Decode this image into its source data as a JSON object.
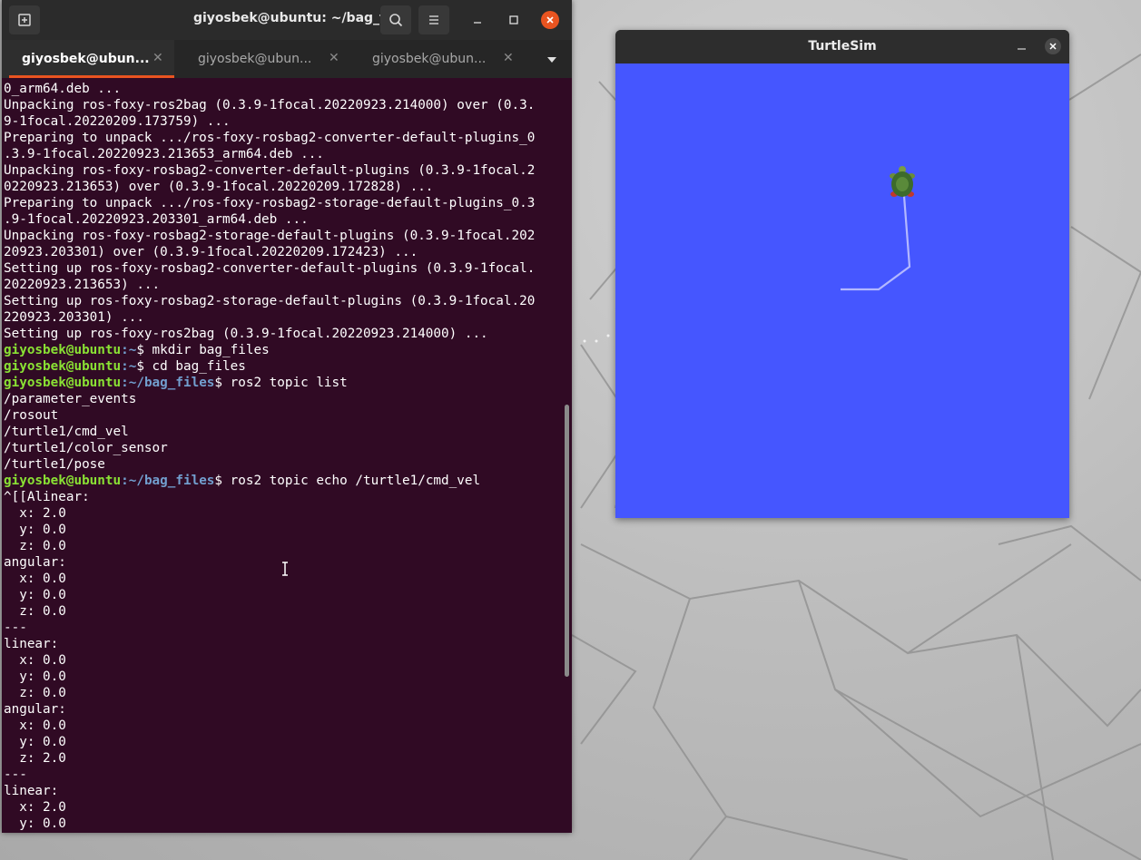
{
  "terminal": {
    "title": "giyosbek@ubuntu: ~/bag_files",
    "tabs": [
      {
        "label": "giyosbek@ubun...",
        "active": true
      },
      {
        "label": "giyosbek@ubun...",
        "active": false
      },
      {
        "label": "giyosbek@ubun...",
        "active": false
      }
    ],
    "prompt_user": "giyosbek@ubuntu",
    "lines": [
      {
        "text": "0_arm64.deb ..."
      },
      {
        "text": "Unpacking ros-foxy-ros2bag (0.3.9-1focal.20220923.214000) over (0.3."
      },
      {
        "text": "9-1focal.20220209.173759) ..."
      },
      {
        "text": "Preparing to unpack .../ros-foxy-rosbag2-converter-default-plugins_0"
      },
      {
        "text": ".3.9-1focal.20220923.213653_arm64.deb ..."
      },
      {
        "text": "Unpacking ros-foxy-rosbag2-converter-default-plugins (0.3.9-1focal.2"
      },
      {
        "text": "0220923.213653) over (0.3.9-1focal.20220209.172828) ..."
      },
      {
        "text": "Preparing to unpack .../ros-foxy-rosbag2-storage-default-plugins_0.3"
      },
      {
        "text": ".9-1focal.20220923.203301_arm64.deb ..."
      },
      {
        "text": "Unpacking ros-foxy-rosbag2-storage-default-plugins (0.3.9-1focal.202"
      },
      {
        "text": "20923.203301) over (0.3.9-1focal.20220209.172423) ..."
      },
      {
        "text": "Setting up ros-foxy-rosbag2-converter-default-plugins (0.3.9-1focal."
      },
      {
        "text": "20220923.213653) ..."
      },
      {
        "text": "Setting up ros-foxy-rosbag2-storage-default-plugins (0.3.9-1focal.20"
      },
      {
        "text": "220923.203301) ..."
      },
      {
        "text": "Setting up ros-foxy-ros2bag (0.3.9-1focal.20220923.214000) ..."
      },
      {
        "prompt": true,
        "path": "~",
        "text": "$ mkdir bag_files"
      },
      {
        "prompt": true,
        "path": "~",
        "text": "$ cd bag_files"
      },
      {
        "prompt": true,
        "path": "~/bag_files",
        "text": "$ ros2 topic list"
      },
      {
        "text": "/parameter_events"
      },
      {
        "text": "/rosout"
      },
      {
        "text": "/turtle1/cmd_vel"
      },
      {
        "text": "/turtle1/color_sensor"
      },
      {
        "text": "/turtle1/pose"
      },
      {
        "prompt": true,
        "path": "~/bag_files",
        "text": "$ ros2 topic echo /turtle1/cmd_vel"
      },
      {
        "text": "^[[Alinear:"
      },
      {
        "text": "  x: 2.0"
      },
      {
        "text": "  y: 0.0"
      },
      {
        "text": "  z: 0.0"
      },
      {
        "text": "angular:"
      },
      {
        "text": "  x: 0.0"
      },
      {
        "text": "  y: 0.0"
      },
      {
        "text": "  z: 0.0"
      },
      {
        "text": "---"
      },
      {
        "text": "linear:"
      },
      {
        "text": "  x: 0.0"
      },
      {
        "text": "  y: 0.0"
      },
      {
        "text": "  z: 0.0"
      },
      {
        "text": "angular:"
      },
      {
        "text": "  x: 0.0"
      },
      {
        "text": "  y: 0.0"
      },
      {
        "text": "  z: 2.0"
      },
      {
        "text": "---"
      },
      {
        "text": "linear:"
      },
      {
        "text": "  x: 2.0"
      },
      {
        "text": "  y: 0.0"
      }
    ]
  },
  "turtlesim": {
    "title": "TurtleSim",
    "background_color": "#4556ff",
    "pen_color": "#b3b8ff"
  },
  "colors": {
    "terminal_bg": "#300a24",
    "prompt_user": "#8ae234",
    "prompt_path": "#729fcf",
    "accent": "#e95420"
  }
}
